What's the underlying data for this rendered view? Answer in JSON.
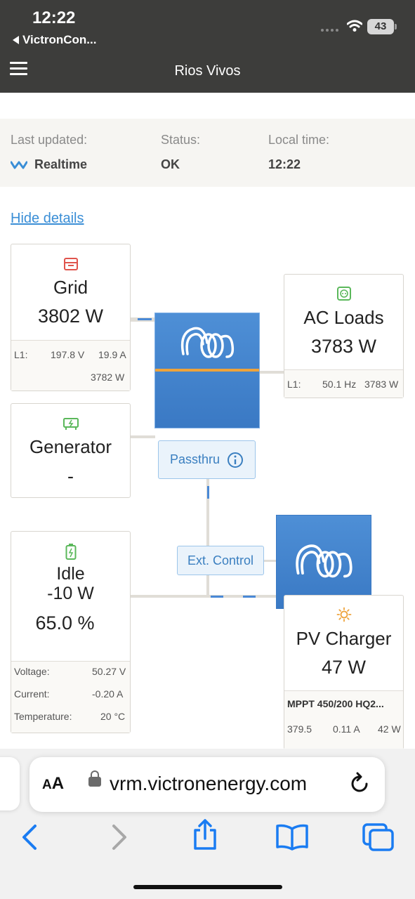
{
  "status_bar": {
    "time": "12:22",
    "back_app": "VictronCon...",
    "battery": "43"
  },
  "header": {
    "title": "Rios Vivos",
    "menu_icon": "hamburger-menu-icon"
  },
  "info": {
    "last_updated_label": "Last updated:",
    "last_updated_value": "Realtime",
    "status_label": "Status:",
    "status_value": "OK",
    "local_time_label": "Local time:",
    "local_time_value": "12:22"
  },
  "hide_details": "Hide details",
  "grid": {
    "icon": "grid-meter-icon",
    "title": "Grid",
    "power": "3802 W",
    "phase": "L1:",
    "voltage": "197.8 V",
    "current": "19.9 A",
    "phase_power": "3782 W"
  },
  "generator": {
    "icon": "generator-icon",
    "title": "Generator",
    "power": "-"
  },
  "ac_loads": {
    "icon": "outlet-icon",
    "title": "AC Loads",
    "power": "3783 W",
    "phase": "L1:",
    "frequency": "50.1 Hz",
    "phase_power": "3783 W"
  },
  "inverter": {
    "icon": "victron-logo-icon",
    "mode_label": "Passthru",
    "info_icon": "info-icon"
  },
  "ext_control": "Ext. Control",
  "battery": {
    "icon": "battery-icon",
    "state": "Idle",
    "power": "-10 W",
    "soc": "65.0 %",
    "voltage_label": "Voltage:",
    "voltage": "50.27 V",
    "current_label": "Current:",
    "current": "-0.20 A",
    "temperature_label": "Temperature:",
    "temperature": "20 °C"
  },
  "pv_charger": {
    "icon": "sun-icon",
    "title": "PV Charger",
    "power": "47 W",
    "device": "MPPT 450/200 HQ2...",
    "voltage": "379.5",
    "current": "0.11 A",
    "device_power": "42 W"
  },
  "safari": {
    "text_size": "AA",
    "url": "vrm.victronenergy.com",
    "icons": [
      "back-icon",
      "forward-icon",
      "share-icon",
      "bookmarks-icon",
      "tabs-icon",
      "reload-icon",
      "lock-icon"
    ]
  },
  "colors": {
    "accent_blue": "#3a8ed6",
    "inverter_blue": "#4a89d6",
    "passthru_orange": "#eea33b",
    "header_bg": "#3d3d3b"
  }
}
